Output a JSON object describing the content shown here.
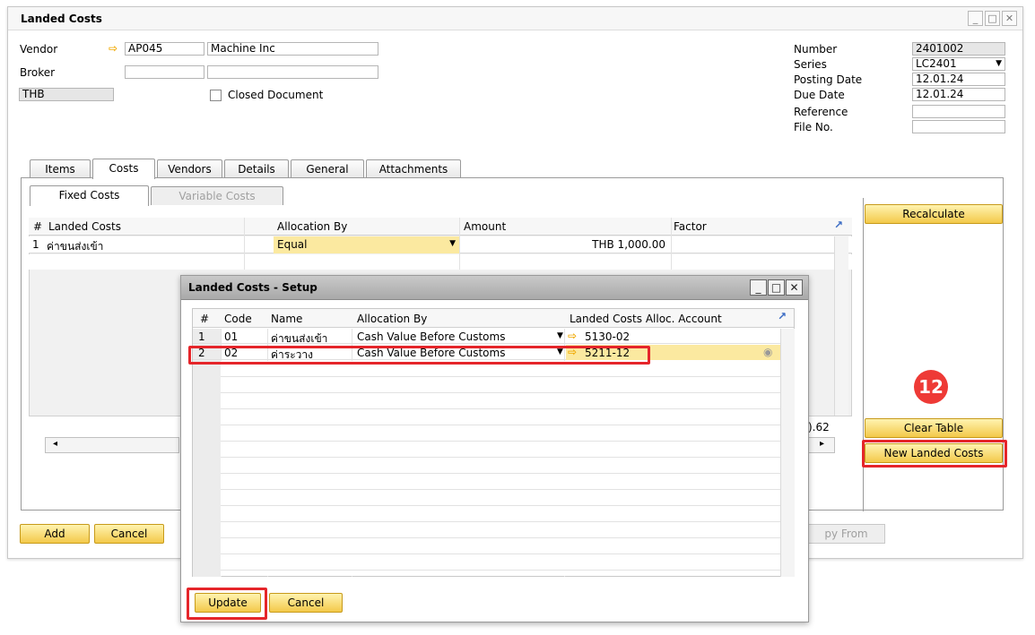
{
  "window": {
    "title": "Landed Costs"
  },
  "header": {
    "vendor_label": "Vendor",
    "vendor_code": "AP045",
    "vendor_name": "Machine Inc",
    "broker_label": "Broker",
    "currency": "THB",
    "closed_document_label": "Closed Document",
    "number_label": "Number",
    "number_value": "2401002",
    "series_label": "Series",
    "series_value": "LC2401",
    "posting_date_label": "Posting Date",
    "posting_date_value": "12.01.24",
    "due_date_label": "Due Date",
    "due_date_value": "12.01.24",
    "reference_label": "Reference",
    "file_no_label": "File No."
  },
  "tabs": [
    "Items",
    "Costs",
    "Vendors",
    "Details",
    "General",
    "Attachments"
  ],
  "subtabs": [
    "Fixed Costs",
    "Variable Costs"
  ],
  "costs_table": {
    "columns": [
      "#",
      "Landed Costs",
      "Allocation By",
      "Amount",
      "Factor"
    ],
    "rows": [
      {
        "num": "1",
        "landed_costs": "ค่าขนส่งเข้า",
        "allocation": "Equal",
        "amount": "THB 1,000.00",
        "factor": ""
      }
    ],
    "partial_total": ").62"
  },
  "side_buttons": {
    "recalculate": "Recalculate",
    "clear_table": "Clear Table",
    "new_landed_costs": "New Landed Costs"
  },
  "bottom_buttons": {
    "add": "Add",
    "cancel": "Cancel",
    "copy_from": "py From"
  },
  "step_badge": "12",
  "dialog": {
    "title": "Landed Costs - Setup",
    "columns": [
      "#",
      "Code",
      "Name",
      "Allocation By",
      "Landed Costs Alloc. Account"
    ],
    "rows": [
      {
        "num": "1",
        "code": "01",
        "name": "ค่าขนส่งเข้า",
        "allocation": "Cash Value Before Customs",
        "account": "5130-02"
      },
      {
        "num": "2",
        "code": "02",
        "name": "ค่าระวาง",
        "allocation": "Cash Value Before Customs",
        "account": "5211-12"
      }
    ],
    "update_label": "Update",
    "cancel_label": "Cancel"
  },
  "colors": {
    "highlight": "#e5252a",
    "badge": "#ee3a36",
    "selected_row": "#fbe9a0",
    "button_yellow": "#f3c94a"
  }
}
